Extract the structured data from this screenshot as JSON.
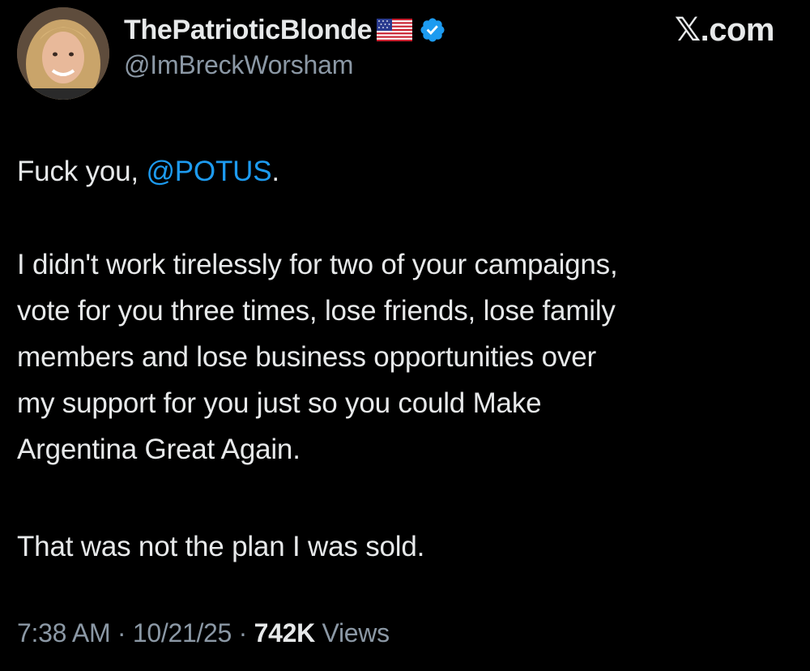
{
  "header": {
    "display_name": "ThePatrioticBlonde",
    "flag_icon": "us-flag-icon",
    "verified_icon": "verified-badge-icon",
    "handle": "@ImBreckWorsham",
    "site_label": "𝕏.com"
  },
  "tweet": {
    "greeting_prefix": "Fuck you, ",
    "mention": "@POTUS",
    "greeting_suffix": ".",
    "paragraph_lines": [
      "I didn't work tirelessly for two of your campaigns,",
      "vote for you three times, lose friends, lose family",
      "members and lose business opportunities over",
      "my support for you just so you could Make",
      "Argentina Great Again."
    ],
    "closing": "That was not the plan I was sold."
  },
  "meta": {
    "time": "7:38 AM",
    "separator": " · ",
    "date": "10/21/25",
    "views_count": "742K",
    "views_label": " Views"
  },
  "colors": {
    "background": "#000000",
    "text": "#e7e9ea",
    "secondary": "#8b98a5",
    "accent": "#1d9bf0"
  }
}
